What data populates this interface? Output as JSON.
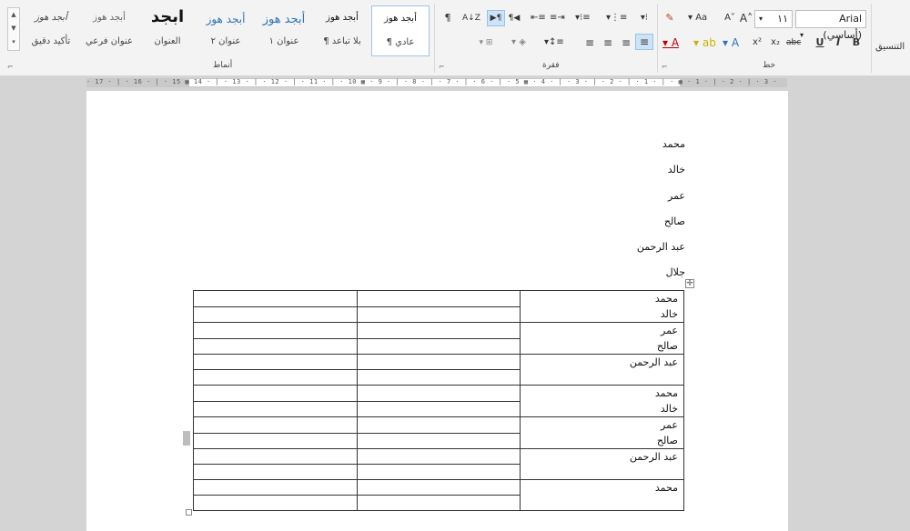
{
  "ribbon": {
    "styles": [
      {
        "sample": "أبجد هوز",
        "name": "¶ عادي",
        "selected": true
      },
      {
        "sample": "أبجد هوز",
        "name": "¶ بلا تباعد"
      },
      {
        "sample": "أبجد هوز",
        "name": "عنوان ١"
      },
      {
        "sample": "أبجد هوز",
        "name": "عنوان ٢"
      },
      {
        "sample": "ابجد",
        "name": "العنوان"
      },
      {
        "sample": "أبجد هوز",
        "name": "عنوان فرعي"
      },
      {
        "sample": "أبجد هوز",
        "name": "تأكيد دقيق"
      }
    ],
    "groups": {
      "styles": "أنماط",
      "paragraph": "فقرة",
      "font": "خط",
      "formatting": "التنسيق"
    },
    "font": {
      "name": "Arial (أساسي)",
      "size": "١١",
      "bold": "B",
      "italic": "I",
      "underline": "U",
      "strike": "abc",
      "subscript": "x₂",
      "superscript": "x²",
      "change_case": "Aa",
      "grow": "A˄",
      "shrink": "A˅"
    },
    "paragraph_icons": [
      "pilcrow-icon",
      "sort-icon",
      "rtl-icon",
      "ltr-icon",
      "increase-indent-icon",
      "decrease-indent-icon",
      "multilevel-list-icon",
      "numbered-list-icon",
      "bullet-list-icon"
    ],
    "accent": "#2b579a"
  },
  "ruler": {
    "labels": "· 17 · | · 16 · | · 15 ▦ 14 · | · 13 · | · 12 · | · 11 · | · 10 ▦ · 9 · | · 8 · | · 7 · | · 6 · | · 5 ▦ · 4 · | · 3 · | · 2 · | · 1 · | · ▦ · 1 · | · 2 · | · 3 ·"
  },
  "document": {
    "lines": [
      "محمد",
      "خالد",
      "عمر",
      "صالح",
      "عبد الرحمن",
      "جلال"
    ],
    "table": [
      [
        "محمد\nخالد",
        "",
        ""
      ],
      [
        "عمر\nصالح",
        "",
        ""
      ],
      [
        "عبد الرحمن",
        "",
        ""
      ],
      [
        "محمد\nخالد",
        "",
        ""
      ],
      [
        "عمر\nصالح",
        "",
        ""
      ],
      [
        "عبد الرحمن",
        "",
        ""
      ],
      [
        "محمد",
        "",
        ""
      ]
    ]
  }
}
